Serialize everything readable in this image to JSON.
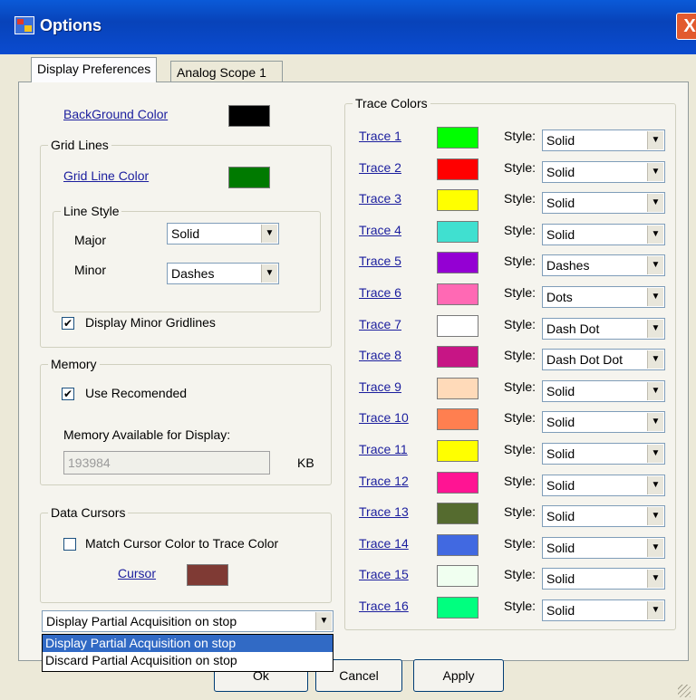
{
  "window": {
    "title": "Options",
    "close_label": "X"
  },
  "tabs": [
    "Display Preferences",
    "Analog Scope 1"
  ],
  "display": {
    "background_color_label": "BackGround Color",
    "background_color": "#000000",
    "grid_lines_label": "Grid Lines",
    "grid_line_color_label": "Grid Line Color",
    "grid_line_color": "#007a00",
    "line_style_label": "Line Style",
    "major_label": "Major",
    "major_value": "Solid",
    "minor_label": "Minor",
    "minor_value": "Dashes",
    "display_minor_label": "Display Minor Gridlines",
    "display_minor_checked": "✔"
  },
  "memory": {
    "label": "Memory",
    "use_recommended_label": "Use Recomended",
    "use_recommended_checked": "✔",
    "available_label": "Memory Available for Display:",
    "available_value": "193984",
    "unit": "KB"
  },
  "cursors": {
    "label": "Data Cursors",
    "match_label": "Match Cursor Color to Trace Color",
    "cursor_label": "Cursor",
    "cursor_color": "#7f3a34"
  },
  "acquisition": {
    "selected": "Display Partial Acquisition on stop",
    "options": [
      "Display Partial Acquisition on stop",
      "Discard Partial Acquisition on stop"
    ]
  },
  "trace_colors": {
    "label": "Trace Colors",
    "style_label": "Style:",
    "traces": [
      {
        "name": "Trace 1",
        "color": "#00ff00",
        "style": "Solid"
      },
      {
        "name": "Trace 2",
        "color": "#ff0000",
        "style": "Solid"
      },
      {
        "name": "Trace 3",
        "color": "#ffff00",
        "style": "Solid"
      },
      {
        "name": "Trace 4",
        "color": "#40e0d0",
        "style": "Solid"
      },
      {
        "name": "Trace 5",
        "color": "#9400d3",
        "style": "Dashes"
      },
      {
        "name": "Trace 6",
        "color": "#ff69b4",
        "style": "Dots"
      },
      {
        "name": "Trace 7",
        "color": "#ffffff",
        "style": "Dash Dot"
      },
      {
        "name": "Trace 8",
        "color": "#c71585",
        "style": "Dash Dot Dot"
      },
      {
        "name": "Trace 9",
        "color": "#ffdab9",
        "style": "Solid"
      },
      {
        "name": "Trace 10",
        "color": "#ff7f50",
        "style": "Solid"
      },
      {
        "name": "Trace 11",
        "color": "#ffff00",
        "style": "Solid"
      },
      {
        "name": "Trace 12",
        "color": "#ff1493",
        "style": "Solid"
      },
      {
        "name": "Trace 13",
        "color": "#556b2f",
        "style": "Solid"
      },
      {
        "name": "Trace 14",
        "color": "#4169e1",
        "style": "Solid"
      },
      {
        "name": "Trace 15",
        "color": "#f0fff0",
        "style": "Solid"
      },
      {
        "name": "Trace 16",
        "color": "#00ff7f",
        "style": "Solid"
      }
    ]
  },
  "buttons": {
    "ok": "Ok",
    "cancel": "Cancel",
    "apply": "Apply"
  },
  "icons": {
    "dropdown_arrow": "▼"
  }
}
